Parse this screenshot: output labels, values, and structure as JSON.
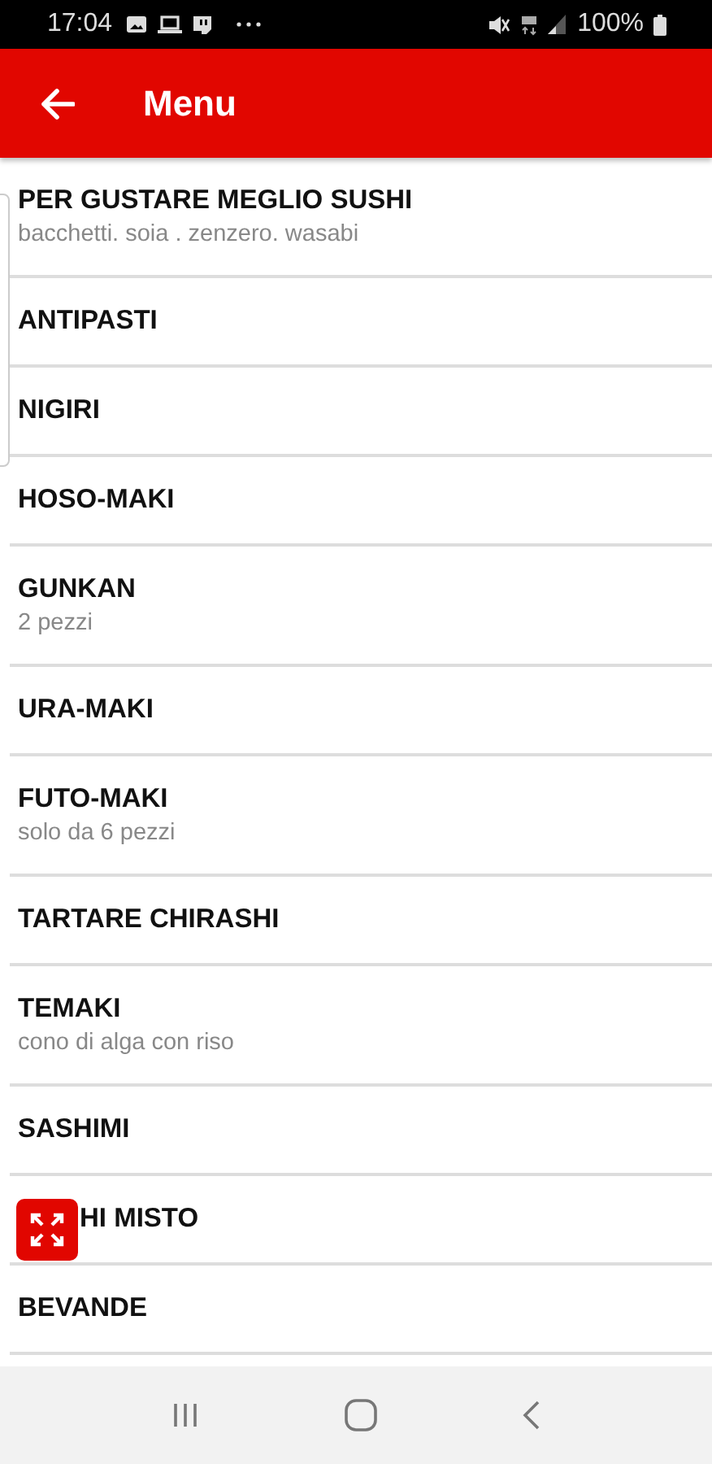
{
  "status_bar": {
    "time": "17:04",
    "battery": "100%"
  },
  "app_bar": {
    "title": "Menu"
  },
  "items": [
    {
      "title": "PER GUSTARE MEGLIO SUSHI",
      "subtitle": "bacchetti. soia . zenzero. wasabi"
    },
    {
      "title": "ANTIPASTI"
    },
    {
      "title": "NIGIRI"
    },
    {
      "title": "HOSO-MAKI"
    },
    {
      "title": "GUNKAN",
      "subtitle": "2 pezzi"
    },
    {
      "title": "URA-MAKI"
    },
    {
      "title": "FUTO-MAKI",
      "subtitle": "solo da 6 pezzi"
    },
    {
      "title": "TARTARE CHIRASHI"
    },
    {
      "title": "TEMAKI",
      "subtitle": "cono di alga con riso"
    },
    {
      "title": "SASHIMI"
    },
    {
      "title": "HI MISTO",
      "covered": true
    },
    {
      "title": "BEVANDE"
    }
  ]
}
